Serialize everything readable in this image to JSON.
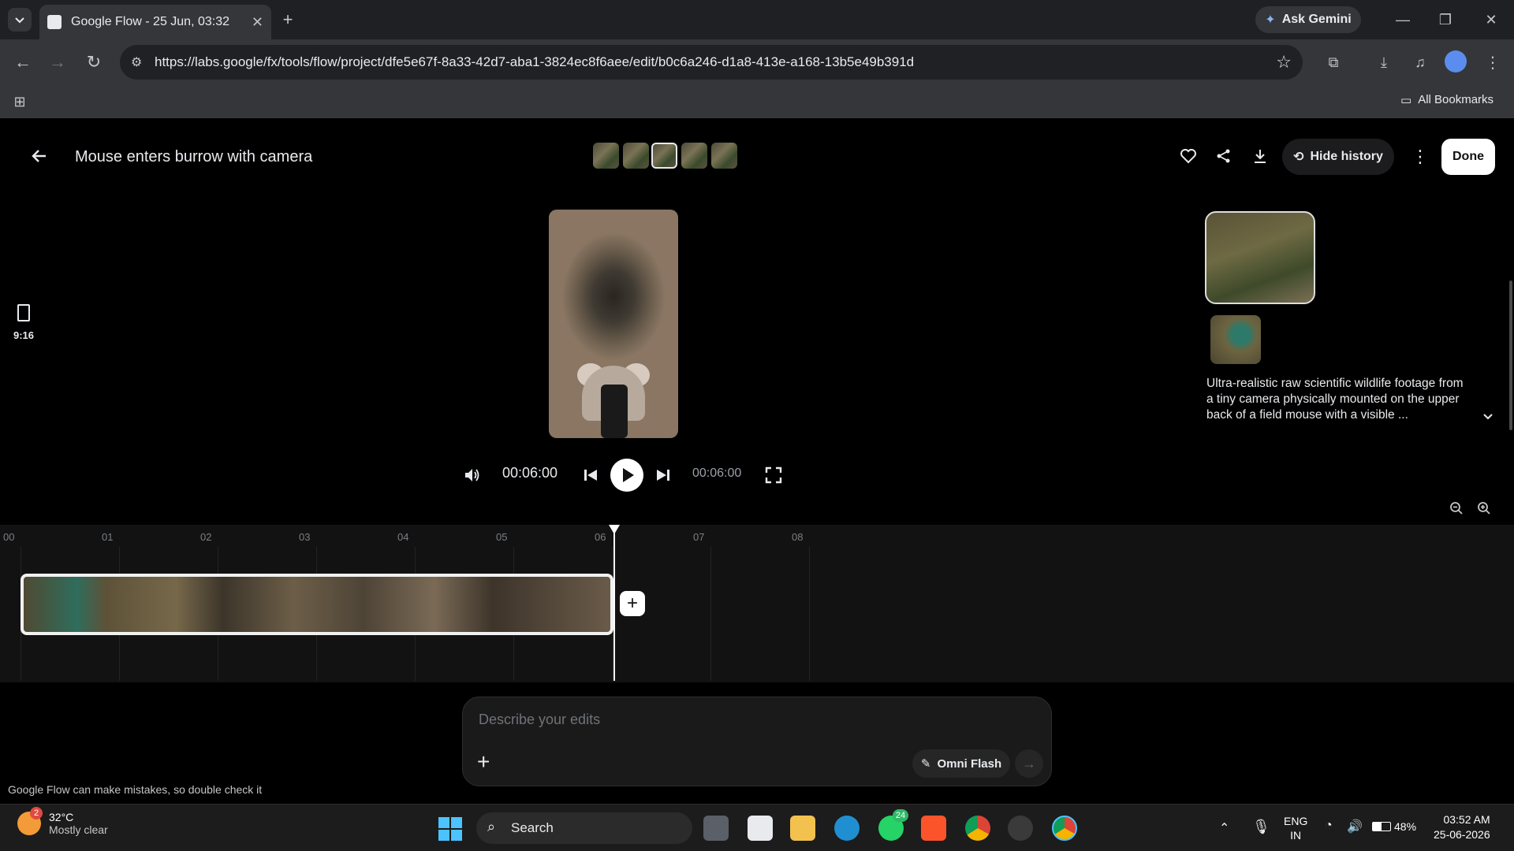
{
  "browser": {
    "tab_title": "Google Flow - 25 Jun, 03:32",
    "ask_gemini": "Ask Gemini",
    "url": "https://labs.google/fx/tools/flow/project/dfe5e67f-8a33-42d7-aba1-3824ec8f6aee/edit/b0c6a246-d1a8-413e-a168-13b5e49b391d",
    "all_bookmarks": "All Bookmarks"
  },
  "app": {
    "title": "Mouse enters burrow with camera",
    "hide_history": "Hide history",
    "done": "Done",
    "aspect_ratio": "9:16"
  },
  "player": {
    "current_time": "00:06:00",
    "total_time": "00:06:00"
  },
  "history": {
    "prompt": "Ultra-realistic raw scientific wildlife footage from a tiny camera physically mounted on the upper back of a field mouse with a visible ..."
  },
  "timeline": {
    "ticks": [
      "00",
      "01",
      "02",
      "03",
      "04",
      "05",
      "06",
      "07",
      "08"
    ]
  },
  "editor": {
    "placeholder": "Describe your edits",
    "model": "Omni Flash",
    "disclaimer": "Google Flow can make mistakes, so double check it"
  },
  "taskbar": {
    "weather_temp": "32°C",
    "weather_desc": "Mostly clear",
    "weather_badge": "2",
    "search": "Search",
    "whatsapp_badge": "24",
    "lang_top": "ENG",
    "lang_bottom": "IN",
    "battery": "48%",
    "time": "03:52 AM",
    "date": "25-06-2026"
  },
  "colors": {
    "background": "#000000",
    "chrome_dark": "#1f2023",
    "chrome_mid": "#35363a",
    "accent_white": "#ffffff"
  }
}
